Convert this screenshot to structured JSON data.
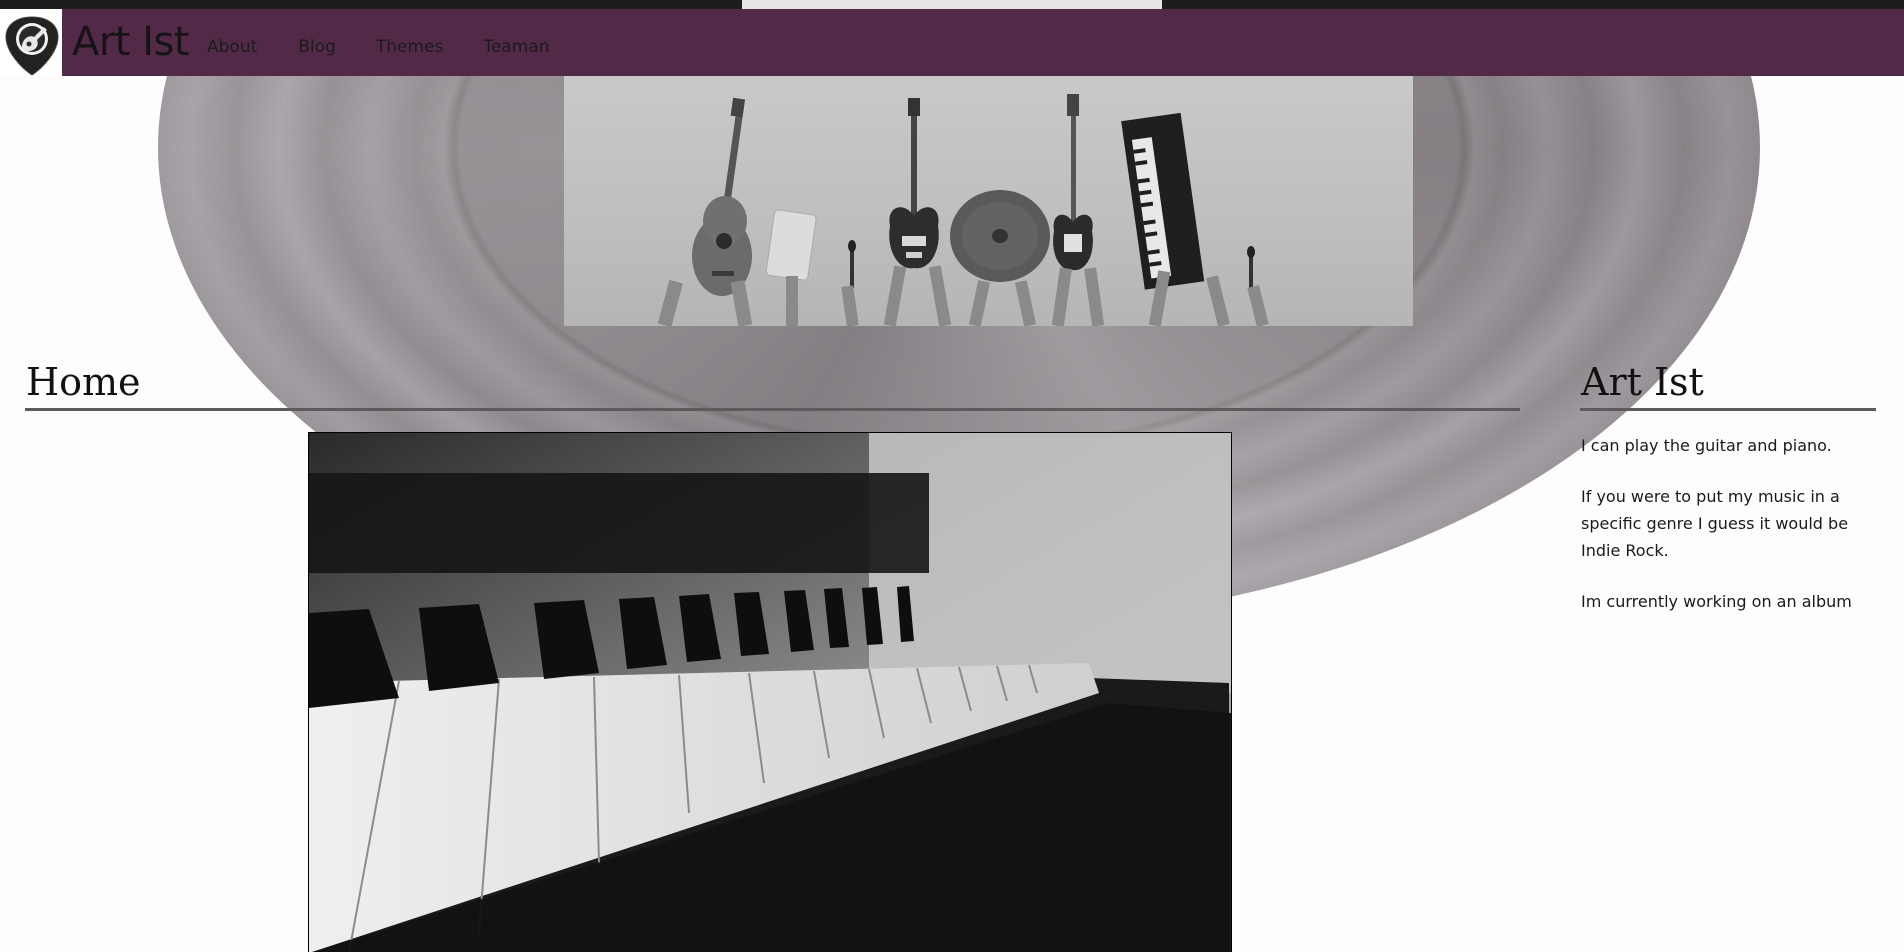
{
  "site": {
    "title": "Art Ist"
  },
  "nav": {
    "items": [
      {
        "label": "About"
      },
      {
        "label": "Blog"
      },
      {
        "label": "Themes"
      },
      {
        "label": "Teaman"
      }
    ]
  },
  "main": {
    "heading": "Home"
  },
  "sidebar": {
    "heading": "Art Ist",
    "paragraphs": [
      "I can play the guitar and piano.",
      "If you were to put my music in a specific genre I guess it would be Indie Rock.",
      "Im currently working on an album"
    ]
  },
  "colors": {
    "header_bg": "#522a47",
    "rule": "#5c5a5c"
  },
  "icons": {
    "logo": "guitar-pick-logo-icon"
  }
}
